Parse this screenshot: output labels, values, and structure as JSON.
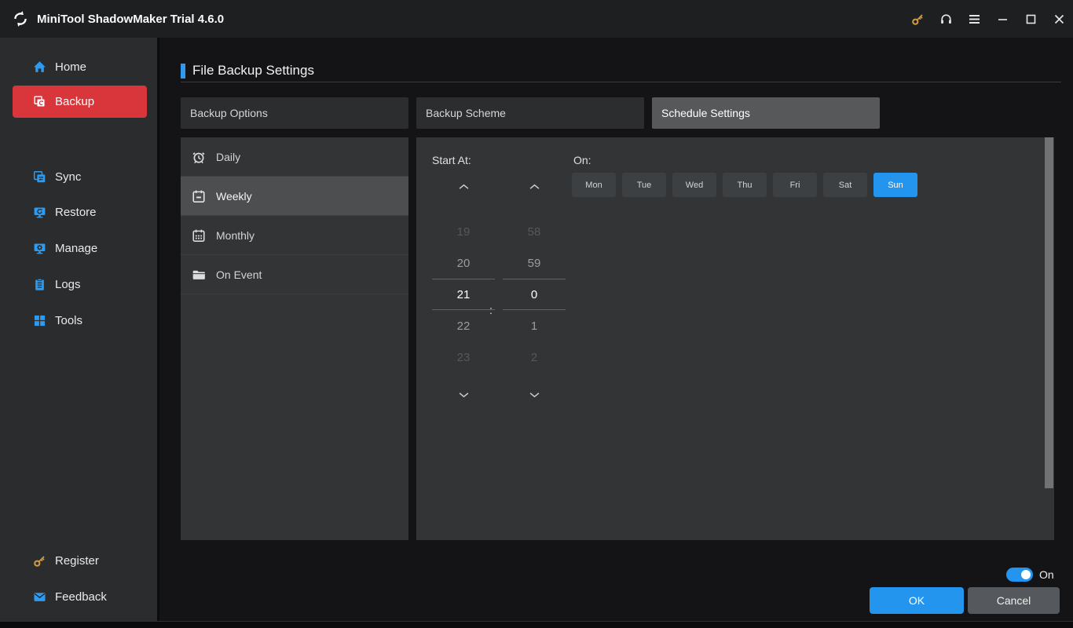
{
  "titlebar": {
    "title": "MiniTool ShadowMaker Trial 4.6.0",
    "icons": [
      "minitool-logo",
      "key-icon",
      "headset-icon",
      "menu-icon",
      "minimize-icon",
      "maximize-icon",
      "close-icon"
    ]
  },
  "sidebar": {
    "items": [
      {
        "label": "Home",
        "icon": "home-icon",
        "active": false
      },
      {
        "label": "Backup",
        "icon": "backup-icon",
        "active": true
      },
      {
        "label": "Sync",
        "icon": "sync-icon",
        "active": false
      },
      {
        "label": "Restore",
        "icon": "restore-icon",
        "active": false
      },
      {
        "label": "Manage",
        "icon": "manage-icon",
        "active": false
      },
      {
        "label": "Logs",
        "icon": "logs-icon",
        "active": false
      },
      {
        "label": "Tools",
        "icon": "tools-icon",
        "active": false
      }
    ],
    "bottom_items": [
      {
        "label": "Register",
        "icon": "key-icon",
        "active": false
      },
      {
        "label": "Feedback",
        "icon": "mail-icon",
        "active": false
      }
    ]
  },
  "main": {
    "page_title": "File Backup Settings",
    "tabs": [
      {
        "label": "Backup Options",
        "active": false
      },
      {
        "label": "Backup Scheme",
        "active": false
      },
      {
        "label": "Schedule Settings",
        "active": true
      }
    ],
    "schedule_types": [
      {
        "label": "Daily",
        "icon": "alarm-clock-icon",
        "active": false
      },
      {
        "label": "Weekly",
        "icon": "calendar-week-icon",
        "active": true
      },
      {
        "label": "Monthly",
        "icon": "calendar-month-icon",
        "active": false
      },
      {
        "label": "On Event",
        "icon": "folder-icon",
        "active": false
      }
    ],
    "start_at_label": "Start At:",
    "time_separator": ":",
    "time": {
      "hours": {
        "options": [
          "19",
          "20",
          "21",
          "22",
          "23"
        ],
        "selected": "21"
      },
      "minutes": {
        "options": [
          "58",
          "59",
          "0",
          "1",
          "2"
        ],
        "selected": "0"
      }
    },
    "on_label": "On:",
    "days": [
      {
        "label": "Mon",
        "selected": false
      },
      {
        "label": "Tue",
        "selected": false
      },
      {
        "label": "Wed",
        "selected": false
      },
      {
        "label": "Thu",
        "selected": false
      },
      {
        "label": "Fri",
        "selected": false
      },
      {
        "label": "Sat",
        "selected": false
      },
      {
        "label": "Sun",
        "selected": true
      }
    ]
  },
  "footer": {
    "toggle_label": "On",
    "toggle_state": "on",
    "ok_label": "OK",
    "cancel_label": "Cancel"
  },
  "colors": {
    "accent_blue": "#2395ee",
    "accent_red": "#d9363c",
    "accent_orange": "#d29a43",
    "panel_gray": "#323436",
    "titlebar_gray": "#1d1f21"
  }
}
